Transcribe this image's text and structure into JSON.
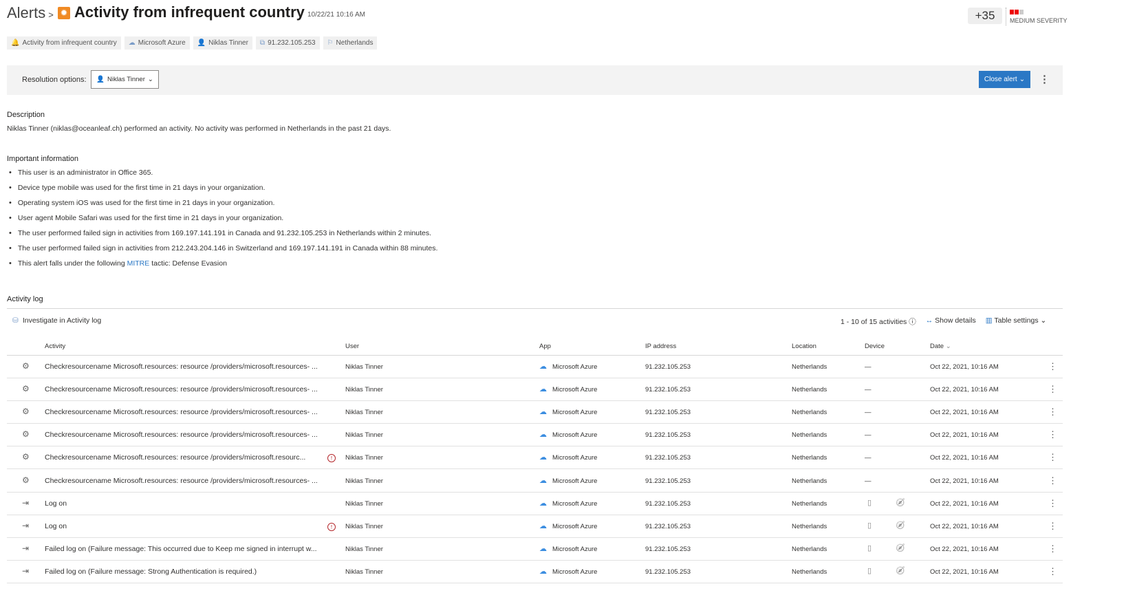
{
  "header": {
    "breadcrumb": "Alerts",
    "separator": ">",
    "title": "Activity from infrequent country",
    "timestamp": "10/22/21 10:16 AM",
    "score": "+35",
    "severity": "MEDIUM SEVERITY",
    "severity_level": 2,
    "severity_max": 3
  },
  "pills": [
    {
      "icon": "bell-icon",
      "glyph": "🔔",
      "label": "Activity from infrequent country"
    },
    {
      "icon": "cloud-icon",
      "glyph": "☁",
      "label": "Microsoft Azure"
    },
    {
      "icon": "user-icon",
      "glyph": "👤",
      "label": "Niklas Tinner"
    },
    {
      "icon": "ip-icon",
      "glyph": "⧉",
      "label": "91.232.105.253"
    },
    {
      "icon": "flag-icon",
      "glyph": "⚐",
      "label": "Netherlands"
    }
  ],
  "resolution": {
    "label": "Resolution options:",
    "user": "Niklas Tinner",
    "close_label": "Close alert"
  },
  "description": {
    "heading": "Description",
    "text": "Niklas Tinner (niklas@oceanleaf.ch) performed an activity. No activity was performed in Netherlands in the past 21 days."
  },
  "important": {
    "heading": "Important information",
    "items": [
      "This user is an administrator in Office 365.",
      "Device type mobile was used for the first time in 21 days in your organization.",
      "Operating system iOS was used for the first time in 21 days in your organization.",
      "User agent Mobile Safari was used for the first time in 21 days in your organization.",
      "The user performed failed sign in activities from 169.197.141.191 in Canada and 91.232.105.253 in Netherlands within 2 minutes.",
      "The user performed failed sign in activities from 212.243.204.146 in Switzerland and 169.197.141.191 in Canada within 88 minutes."
    ],
    "last_prefix": "This alert falls under the following ",
    "last_link": "MITRE",
    "last_suffix": " tactic: Defense Evasion"
  },
  "activity_log": {
    "heading": "Activity log",
    "investigate": "Investigate in Activity log",
    "count": "1 - 10 of 15 activities",
    "show_details": "Show details",
    "table_settings": "Table settings",
    "columns": {
      "activity": "Activity",
      "user": "User",
      "app": "App",
      "ip": "IP address",
      "location": "Location",
      "device": "Device",
      "date": "Date"
    },
    "rows": [
      {
        "type": "resource",
        "activity": "Checkresourcename Microsoft.resources: resource /providers/microsoft.resources- ...",
        "warn": false,
        "user": "Niklas Tinner",
        "app": "Microsoft Azure",
        "ip": "91.232.105.253",
        "location": "Netherlands",
        "device": "—",
        "date": "Oct 22, 2021, 10:16 AM"
      },
      {
        "type": "resource",
        "activity": "Checkresourcename Microsoft.resources: resource /providers/microsoft.resources- ...",
        "warn": false,
        "user": "Niklas Tinner",
        "app": "Microsoft Azure",
        "ip": "91.232.105.253",
        "location": "Netherlands",
        "device": "—",
        "date": "Oct 22, 2021, 10:16 AM"
      },
      {
        "type": "resource",
        "activity": "Checkresourcename Microsoft.resources: resource /providers/microsoft.resources- ...",
        "warn": false,
        "user": "Niklas Tinner",
        "app": "Microsoft Azure",
        "ip": "91.232.105.253",
        "location": "Netherlands",
        "device": "—",
        "date": "Oct 22, 2021, 10:16 AM"
      },
      {
        "type": "resource",
        "activity": "Checkresourcename Microsoft.resources: resource /providers/microsoft.resources- ...",
        "warn": false,
        "user": "Niklas Tinner",
        "app": "Microsoft Azure",
        "ip": "91.232.105.253",
        "location": "Netherlands",
        "device": "—",
        "date": "Oct 22, 2021, 10:16 AM"
      },
      {
        "type": "resource",
        "activity": "Checkresourcename Microsoft.resources: resource /providers/microsoft.resourc...",
        "warn": true,
        "user": "Niklas Tinner",
        "app": "Microsoft Azure",
        "ip": "91.232.105.253",
        "location": "Netherlands",
        "device": "—",
        "date": "Oct 22, 2021, 10:16 AM"
      },
      {
        "type": "resource",
        "activity": "Checkresourcename Microsoft.resources: resource /providers/microsoft.resources- ...",
        "warn": false,
        "user": "Niklas Tinner",
        "app": "Microsoft Azure",
        "ip": "91.232.105.253",
        "location": "Netherlands",
        "device": "—",
        "date": "Oct 22, 2021, 10:16 AM"
      },
      {
        "type": "logon",
        "activity": "Log on",
        "warn": false,
        "user": "Niklas Tinner",
        "app": "Microsoft Azure",
        "ip": "91.232.105.253",
        "location": "Netherlands",
        "device": "icons",
        "date": "Oct 22, 2021, 10:16 AM"
      },
      {
        "type": "logon",
        "activity": "Log on",
        "warn": true,
        "user": "Niklas Tinner",
        "app": "Microsoft Azure",
        "ip": "91.232.105.253",
        "location": "Netherlands",
        "device": "icons",
        "date": "Oct 22, 2021, 10:16 AM"
      },
      {
        "type": "logon",
        "activity": "Failed log on (Failure message: This occurred due to Keep me signed in interrupt w...",
        "warn": false,
        "user": "Niklas Tinner",
        "app": "Microsoft Azure",
        "ip": "91.232.105.253",
        "location": "Netherlands",
        "device": "icons",
        "date": "Oct 22, 2021, 10:16 AM"
      },
      {
        "type": "logon",
        "activity": "Failed log on (Failure message: Strong Authentication is required.)",
        "warn": false,
        "user": "Niklas Tinner",
        "app": "Microsoft Azure",
        "ip": "91.232.105.253",
        "location": "Netherlands",
        "device": "icons",
        "date": "Oct 22, 2021, 10:16 AM"
      }
    ]
  }
}
